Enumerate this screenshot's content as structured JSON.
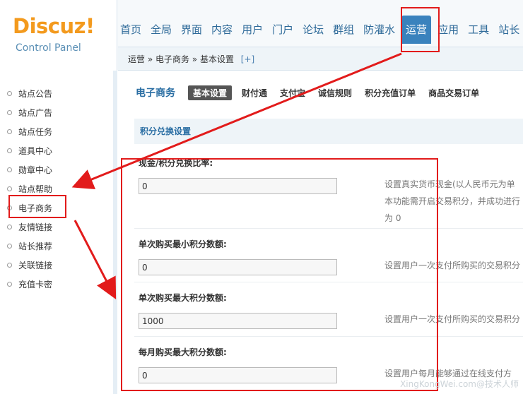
{
  "logo": {
    "brand": "Discuz",
    "bang": "!",
    "subtitle": "Control Panel"
  },
  "nav": {
    "items": [
      {
        "label": "首页"
      },
      {
        "label": "全局"
      },
      {
        "label": "界面"
      },
      {
        "label": "内容"
      },
      {
        "label": "用户"
      },
      {
        "label": "门户"
      },
      {
        "label": "论坛"
      },
      {
        "label": "群组"
      },
      {
        "label": "防灌水"
      },
      {
        "label": "运营"
      },
      {
        "label": "应用"
      },
      {
        "label": "工具"
      },
      {
        "label": "站长"
      }
    ],
    "active_index": 9
  },
  "breadcrumb": {
    "text": "运营 » 电子商务 » 基本设置",
    "plus": "[+]"
  },
  "sidebar": {
    "items": [
      {
        "label": "站点公告"
      },
      {
        "label": "站点广告"
      },
      {
        "label": "站点任务"
      },
      {
        "label": "道具中心"
      },
      {
        "label": "勋章中心"
      },
      {
        "label": "站点帮助"
      },
      {
        "label": "电子商务"
      },
      {
        "label": "友情链接"
      },
      {
        "label": "站长推荐"
      },
      {
        "label": "关联链接"
      },
      {
        "label": "充值卡密"
      }
    ]
  },
  "main": {
    "section_title": "电子商务",
    "tabs": [
      {
        "label": "基本设置",
        "active": true
      },
      {
        "label": "财付通"
      },
      {
        "label": "支付宝"
      },
      {
        "label": "诚信规则"
      },
      {
        "label": "积分充值订单"
      },
      {
        "label": "商品交易订单"
      }
    ],
    "subheading": "积分兑换设置",
    "fields": [
      {
        "label": "现金/积分兑换比率:",
        "value": "0",
        "desc_lines": [
          "设置真实货币现金(以人民币元为单",
          "本功能需开启交易积分，并成功进行",
          "为 0"
        ]
      },
      {
        "label": "单次购买最小积分数额:",
        "value": "0",
        "desc_lines": [
          "设置用户一次支付所购买的交易积分"
        ]
      },
      {
        "label": "单次购买最大积分数额:",
        "value": "1000",
        "desc_lines": [
          "设置用户一次支付所购买的交易积分"
        ]
      },
      {
        "label": "每月购买最大积分数额:",
        "value": "0",
        "desc_lines": [
          "设置用户每月能够通过在线支付方"
        ]
      }
    ]
  },
  "watermark": "XingKongWei.com@技术人师",
  "colors": {
    "accent": "#3a82bd",
    "annotation": "#e21b1b",
    "brand": "#f39a1e"
  }
}
